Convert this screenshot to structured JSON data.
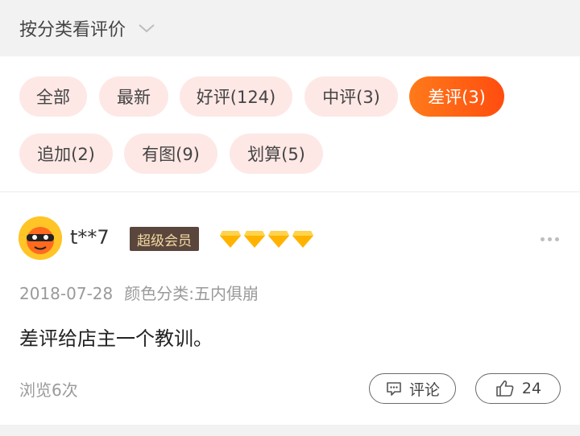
{
  "header": {
    "title": "按分类看评价"
  },
  "filters": [
    {
      "label": "全部",
      "active": false
    },
    {
      "label": "最新",
      "active": false
    },
    {
      "label": "好评(124)",
      "active": false
    },
    {
      "label": "中评(3)",
      "active": false
    },
    {
      "label": "差评(3)",
      "active": true
    },
    {
      "label": "追加(2)",
      "active": false
    },
    {
      "label": "有图(9)",
      "active": false
    },
    {
      "label": "划算(5)",
      "active": false
    }
  ],
  "review": {
    "username": "t**7",
    "vip_badge": "超级会员",
    "gem_count": 4,
    "date": "2018-07-28",
    "spec": "颜色分类:五内俱崩",
    "content": "差评给店主一个教训。",
    "views": "浏览6次",
    "comment_label": "评论",
    "like_count": "24"
  },
  "colors": {
    "accent": "#ff5a12",
    "chip_bg": "#fde8e5",
    "vip_bg": "#5a463c",
    "vip_text": "#f3d9a4",
    "gem": "#ffb300"
  }
}
